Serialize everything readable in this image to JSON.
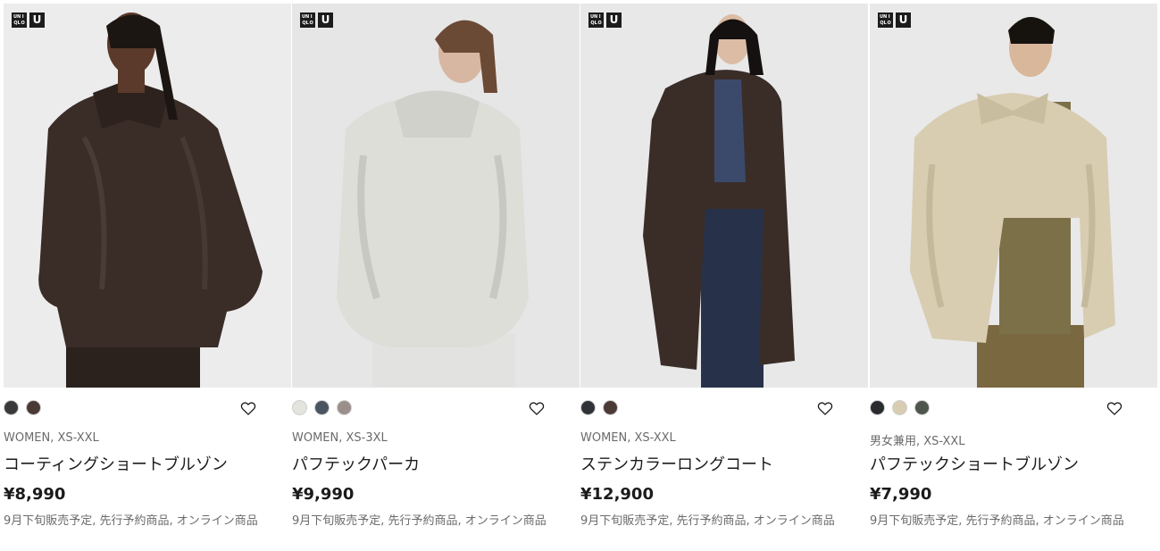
{
  "brand": {
    "logo_text": "UNIQLO",
    "logo_u": "U"
  },
  "products": [
    {
      "meta": "WOMEN, XS-XXL",
      "name": "コーティングショートブルゾン",
      "price": "¥8,990",
      "note": "9月下旬販売予定, 先行予約商品, オンライン商品",
      "swatches": [
        "#3a3a3a",
        "#4a3a36"
      ],
      "garment_color": "#3a2c27",
      "bg_color": "#ececed"
    },
    {
      "meta": "WOMEN, XS-3XL",
      "name": "パフテックパーカ",
      "price": "¥9,990",
      "note": "9月下旬販売予定, 先行予約商品, オンライン商品",
      "swatches": [
        "#e4e4dd",
        "#4b5461",
        "#9b8f8c"
      ],
      "garment_color": "#dcded7",
      "bg_color": "#e6e6e7"
    },
    {
      "meta": "WOMEN, XS-XXL",
      "name": "ステンカラーロングコート",
      "price": "¥12,900",
      "note": "9月下旬販売予定, 先行予約商品, オンライン商品",
      "swatches": [
        "#2f3236",
        "#4b3a36"
      ],
      "garment_color": "#3a2d28",
      "bg_color": "#e8e8e9"
    },
    {
      "meta": "男女兼用, XS-XXL",
      "name": "パフテックショートブルゾン",
      "price": "¥7,990",
      "note": "9月下旬販売予定, 先行予約商品, オンライン商品",
      "swatches": [
        "#2a2b2e",
        "#d8ccb3",
        "#4e554d"
      ],
      "garment_color": "#d8cdb1",
      "bg_color": "#e9e9ea"
    }
  ],
  "icons": {
    "favorite": "heart-outline-icon"
  }
}
